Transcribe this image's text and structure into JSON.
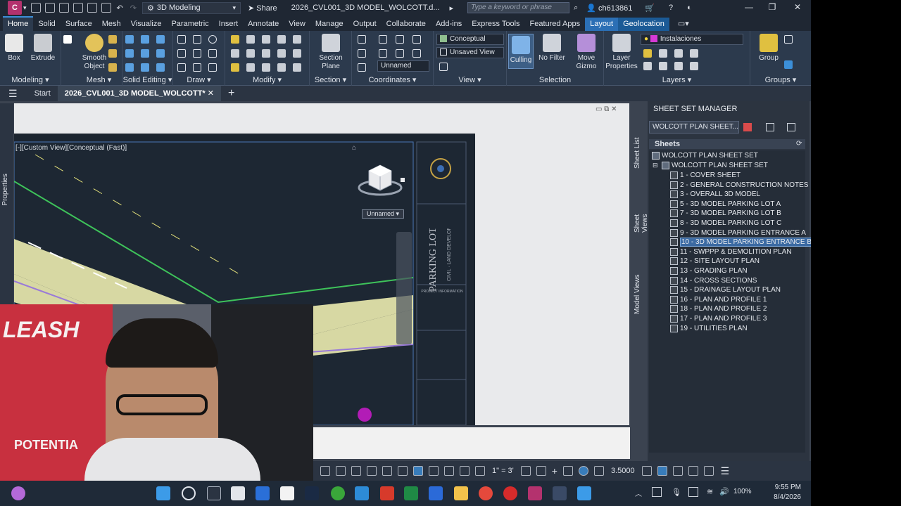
{
  "app": {
    "logo": "C",
    "workspace": "3D Modeling",
    "share": "Share",
    "doc_title": "2026_CVL001_3D MODEL_WOLCOTT.d...",
    "search_placeholder": "Type a keyword or phrase",
    "user": "ch613861"
  },
  "tabs": [
    "Home",
    "Solid",
    "Surface",
    "Mesh",
    "Visualize",
    "Parametric",
    "Insert",
    "Annotate",
    "View",
    "Manage",
    "Output",
    "Collaborate",
    "Add-ins",
    "Express Tools",
    "Featured Apps",
    "Layout",
    "Geolocation"
  ],
  "ribbon": {
    "modeling": {
      "label": "Modeling",
      "box": "Box",
      "extrude": "Extrude",
      "smooth_object": "Smooth Object"
    },
    "mesh": {
      "label": "Mesh"
    },
    "solid_editing": {
      "label": "Solid Editing"
    },
    "draw": {
      "label": "Draw"
    },
    "modify": {
      "label": "Modify"
    },
    "section": {
      "label": "Section",
      "section_plane": "Section Plane"
    },
    "coordinates": {
      "label": "Coordinates",
      "ucs": "Unnamed"
    },
    "view": {
      "label": "View",
      "visual_style": "Conceptual",
      "saved_view": "Unsaved View"
    },
    "selection": {
      "label": "Selection",
      "culling": "Culling",
      "no_filter": "No Filter",
      "move_gizmo": "Move Gizmo"
    },
    "layers": {
      "label": "Layers",
      "layer_properties": "Layer Properties",
      "current_layer": "Instalaciones"
    },
    "groups": {
      "label": "Groups",
      "group": "Group"
    }
  },
  "doctabs": {
    "start": "Start",
    "active": "2026_CVL001_3D MODEL_WOLCOTT*"
  },
  "viewport": {
    "label": "[-][Custom View][Conceptual (Fast)]",
    "viewcube_label": "Unnamed",
    "sidebar": "Properties"
  },
  "titleblock": {
    "lines": [
      "PARKING LOT",
      "CIVIL · LAND DEVELOPMENT",
      "PROJECT INFORMATION"
    ]
  },
  "ssm": {
    "title": "SHEET SET MANAGER",
    "select": "WOLCOTT PLAN SHEET...",
    "sheets_header": "Sheets",
    "tab_sheet_list": "Sheet List",
    "tab_sheet_views": "Sheet Views",
    "tab_model_views": "Model Views",
    "root": "WOLCOTT PLAN SHEET SET",
    "subset": "WOLCOTT PLAN SHEET SET",
    "sheets": [
      "1 - COVER SHEET",
      "2 - GENERAL CONSTRUCTION NOTES",
      "3 - OVERALL 3D MODEL",
      "5 - 3D MODEL PARKING LOT A",
      "7 - 3D MODEL PARKING LOT B",
      "8 - 3D MODEL PARKING LOT C",
      "9 - 3D MODEL PARKING ENTRANCE A",
      "10 - 3D MODEL PARKING ENTRANCE B",
      "11 - SWPPP & DEMOLITION PLAN",
      "12 - SITE LAYOUT PLAN",
      "13 - GRADING PLAN",
      "14 - CROSS SECTIONS",
      "15 - DRAINAGE LAYOUT PLAN",
      "16 - PLAN AND PROFILE 1",
      "18 - PLAN AND PROFILE 2",
      "17 - PLAN AND PROFILE 3",
      "19 - UTILITIES PLAN"
    ],
    "selected_index": 7
  },
  "status": {
    "scale": "1\" = 3'",
    "value": "3.5000"
  },
  "taskbar": {
    "battery": "100%",
    "time": "9:55 PM",
    "date": "8/4/2026"
  },
  "webcam": {
    "wall_text_1": "LEASH",
    "wall_text_2": "POTENTIA"
  }
}
